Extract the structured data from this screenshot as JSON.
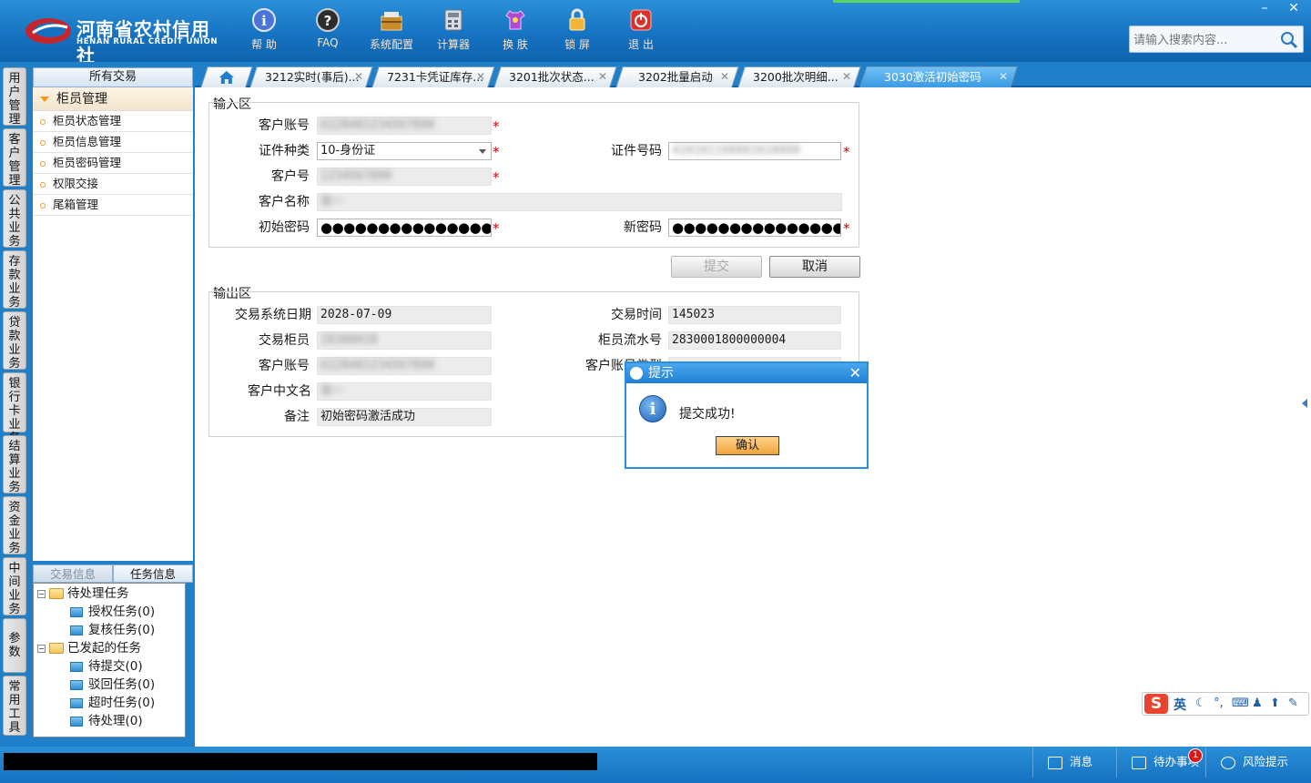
{
  "brand": {
    "name_cn": "河南省农村信用社",
    "name_en": "HENAN RURAL CREDIT UNION"
  },
  "toolbar": [
    {
      "label": "帮 助",
      "icon": "info-icon"
    },
    {
      "label": "FAQ",
      "icon": "question-icon"
    },
    {
      "label": "系统配置",
      "icon": "toolbox-icon"
    },
    {
      "label": "计算器",
      "icon": "calculator-icon"
    },
    {
      "label": "换 肤",
      "icon": "shirt-icon"
    },
    {
      "label": "锁 屏",
      "icon": "lock-icon"
    },
    {
      "label": "退 出",
      "icon": "power-icon"
    }
  ],
  "search": {
    "placeholder": "请输入搜索内容..."
  },
  "vertical_tabs": [
    "用户管理",
    "客户管理",
    "公共业务",
    "存款业务",
    "贷款业务",
    "银行卡业务",
    "结算业务",
    "资金业务",
    "中间业务",
    "参数",
    "常用工具"
  ],
  "left_panel": {
    "header": "所有交易",
    "group": "柜员管理",
    "items": [
      "柜员状态管理",
      "柜员信息管理",
      "柜员密码管理",
      "权限交接",
      "尾箱管理"
    ],
    "bottom_tabs": [
      "交易信息",
      "任务信息"
    ],
    "tree": {
      "pending": "待处理任务",
      "pending_children": [
        "授权任务(0)",
        "复核任务(0)"
      ],
      "initiated": "已发起的任务",
      "initiated_children": [
        "待提交(0)",
        "驳回任务(0)",
        "超时任务(0)",
        "待处理(0)"
      ]
    }
  },
  "tabs": [
    {
      "label": "3212实时(事后)..."
    },
    {
      "label": "7231卡凭证库存..."
    },
    {
      "label": "3201批次状态..."
    },
    {
      "label": "3202批量启动"
    },
    {
      "label": "3200批次明细..."
    },
    {
      "label": "3030激活初始密码",
      "active": true
    }
  ],
  "input_section": {
    "title": "输入区",
    "account_label": "客户账号",
    "account_value": "6228481234567890",
    "id_type_label": "证件种类",
    "id_type_value": "10-身份证",
    "id_no_label": "证件号码",
    "id_no_value": "410101198001010000",
    "cust_no_label": "客户号",
    "cust_no_value": "1234567890",
    "cust_name_label": "客户名称",
    "cust_name_value": "张一",
    "init_pwd_label": "初始密码",
    "init_pwd_value": "●●●●●●●●●●●●●●●",
    "new_pwd_label": "新密码",
    "new_pwd_value": "●●●●●●●●●●●●●●●",
    "required_mark": "*"
  },
  "buttons": {
    "submit": "提交",
    "cancel": "取消"
  },
  "output_section": {
    "title": "输出区",
    "sys_date_label": "交易系统日期",
    "sys_date_value": "2028-07-09",
    "time_label": "交易时间",
    "time_value": "145023",
    "teller_label": "交易柜员",
    "teller_value": "28300018",
    "serial_label": "柜员流水号",
    "serial_value": "2830001800000004",
    "account_label": "客户账号",
    "account_value": "6228481234567890",
    "account_type_label": "客户账号类型",
    "cn_name_label": "客户中文名",
    "cn_name_value": "张一",
    "remark_label": "备注",
    "remark_value": "初始密码激活成功"
  },
  "dialog": {
    "title": "提示",
    "message": "提交成功!",
    "ok": "确认"
  },
  "ime": {
    "mode": "英"
  },
  "statusbar": {
    "messages": "消息",
    "todo": "待办事项",
    "todo_count": "1",
    "risk": "风险提示"
  },
  "colors": {
    "primary": "#1f7fc9",
    "active_tab": "#3a9ae3",
    "required": "#d00000",
    "ok_button": "#f0a43c"
  }
}
